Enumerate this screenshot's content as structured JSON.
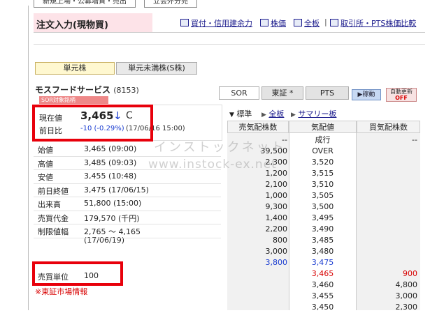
{
  "top_tabs": [
    "新規上場・公募増資・売出",
    "立会外分売"
  ],
  "header": {
    "title": "注文入力(現物買)",
    "tools": [
      "買付・信用建余力",
      "株価",
      "全板",
      "取引所・PTS株価比較"
    ],
    "tool_separator": "|"
  },
  "unit_tabs": [
    "単元株",
    "単元未満株(S株)"
  ],
  "stock": {
    "name": "モスフードサービス",
    "code": "(8153)"
  },
  "markets": [
    "SOR",
    "東証 *",
    "PTS"
  ],
  "buttons": {
    "move": "▶稼動",
    "auto_update_line1": "自動更新",
    "auto_update_line2": "OFF"
  },
  "sor_badge": "SOR対象銘柄",
  "current": {
    "label": "現在値",
    "price": "3,465",
    "arrow": "↓",
    "flag": "C",
    "change_label": "前日比",
    "change": "-10 (-0.29%)",
    "change_time": "(17/06/16 15:00)"
  },
  "quote_rows": [
    {
      "label": "始値",
      "value": "3,465 (09:00)"
    },
    {
      "label": "高値",
      "value": "3,485 (09:03)"
    },
    {
      "label": "安値",
      "value": "3,455 (10:48)"
    },
    {
      "label": "前日終値",
      "value": "3,475 (17/06/15)"
    },
    {
      "label": "出来高",
      "value": "51,800 (15:00)"
    },
    {
      "label": "売買代金",
      "value": "179,570 (千円)"
    },
    {
      "label": "制限値幅",
      "value": "2,765 〜 4,165",
      "value2": "(17/06/19)"
    }
  ],
  "trade_unit": {
    "label": "売買単位",
    "value": "100"
  },
  "footnote": "※東証市場情報",
  "watermark": {
    "line1": "インストックネット",
    "line2": "www.instock-ex.net"
  },
  "board_views": {
    "standard": "標準",
    "full": "全板",
    "summary": "サマリー板"
  },
  "board": {
    "headers": [
      "売気配株数",
      "気配値",
      "買気配株数"
    ],
    "rows": [
      {
        "sell": "--",
        "price": "成行",
        "buy": "--"
      },
      {
        "sell": "39,500",
        "price": "OVER",
        "buy": ""
      },
      {
        "sell": "2,300",
        "price": "3,520",
        "buy": ""
      },
      {
        "sell": "1,200",
        "price": "3,515",
        "buy": ""
      },
      {
        "sell": "2,100",
        "price": "3,510",
        "buy": ""
      },
      {
        "sell": "1,000",
        "price": "3,505",
        "buy": ""
      },
      {
        "sell": "9,300",
        "price": "3,500",
        "buy": ""
      },
      {
        "sell": "1,400",
        "price": "3,495",
        "buy": ""
      },
      {
        "sell": "2,200",
        "price": "3,490",
        "buy": ""
      },
      {
        "sell": "800",
        "price": "3,485",
        "buy": ""
      },
      {
        "sell": "3,000",
        "price": "3,480",
        "buy": ""
      },
      {
        "sell": "3,800",
        "price": "3,475",
        "buy": ""
      },
      {
        "sell": "",
        "price": "3,465",
        "buy": "900"
      },
      {
        "sell": "",
        "price": "3,460",
        "buy": "4,800"
      },
      {
        "sell": "",
        "price": "3,455",
        "buy": "3,000"
      },
      {
        "sell": "",
        "price": "3,450",
        "buy": "2,300"
      }
    ]
  },
  "colors": {
    "highlight_box": "#e8000b",
    "header_bg": "#fde3e8",
    "link": "#1a1a8c",
    "down": "#1a3cd0",
    "up": "#d80000"
  }
}
